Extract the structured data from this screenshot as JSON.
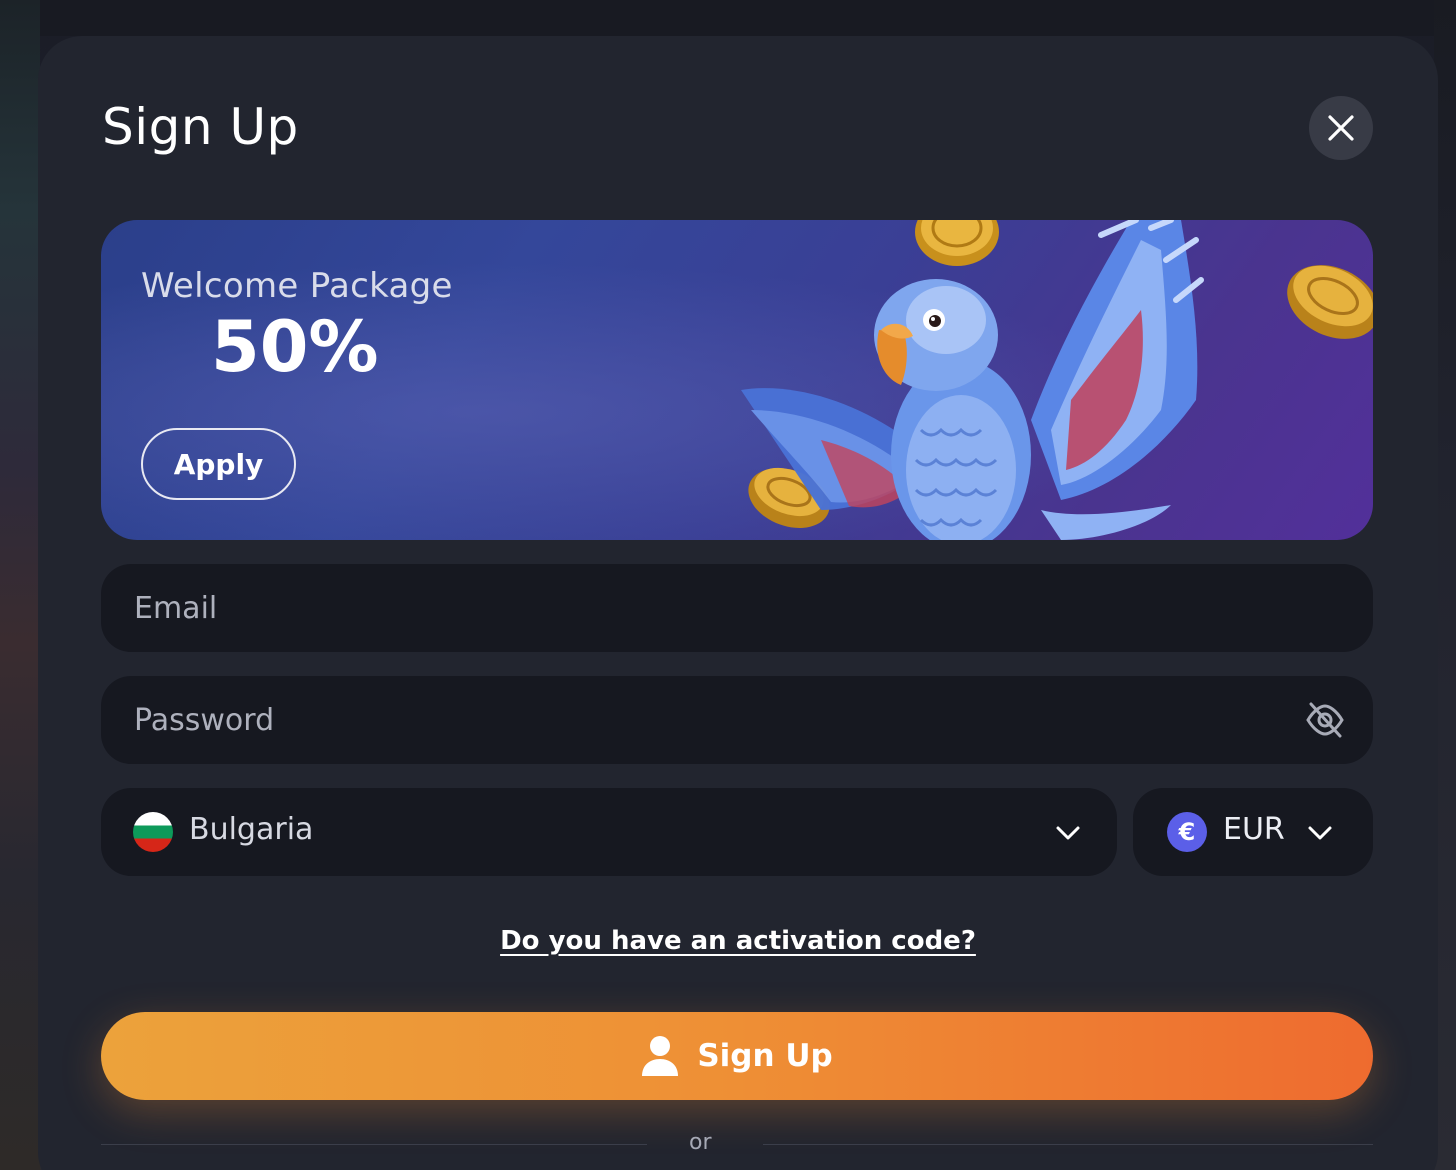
{
  "modal": {
    "title": "Sign Up"
  },
  "banner": {
    "subtitle": "Welcome Package",
    "headline": "50%",
    "apply_label": "Apply"
  },
  "form": {
    "email_placeholder": "Email",
    "password_placeholder": "Password",
    "country": "Bulgaria",
    "currency": "EUR",
    "currency_symbol": "€"
  },
  "activation_link": "Do you have an activation code?",
  "signup_button": "Sign Up",
  "divider_text": "or",
  "colors": {
    "modal_bg": "#22252f",
    "field_bg": "#161820",
    "accent_start": "#eca23b",
    "accent_end": "#ee6b2f",
    "currency_badge": "#5b5fe8"
  },
  "icons": {
    "close": "close-icon",
    "password_toggle": "eye-off-icon",
    "dropdown": "chevron-down-icon",
    "user": "user-icon",
    "flag": "bulgaria-flag-icon"
  }
}
